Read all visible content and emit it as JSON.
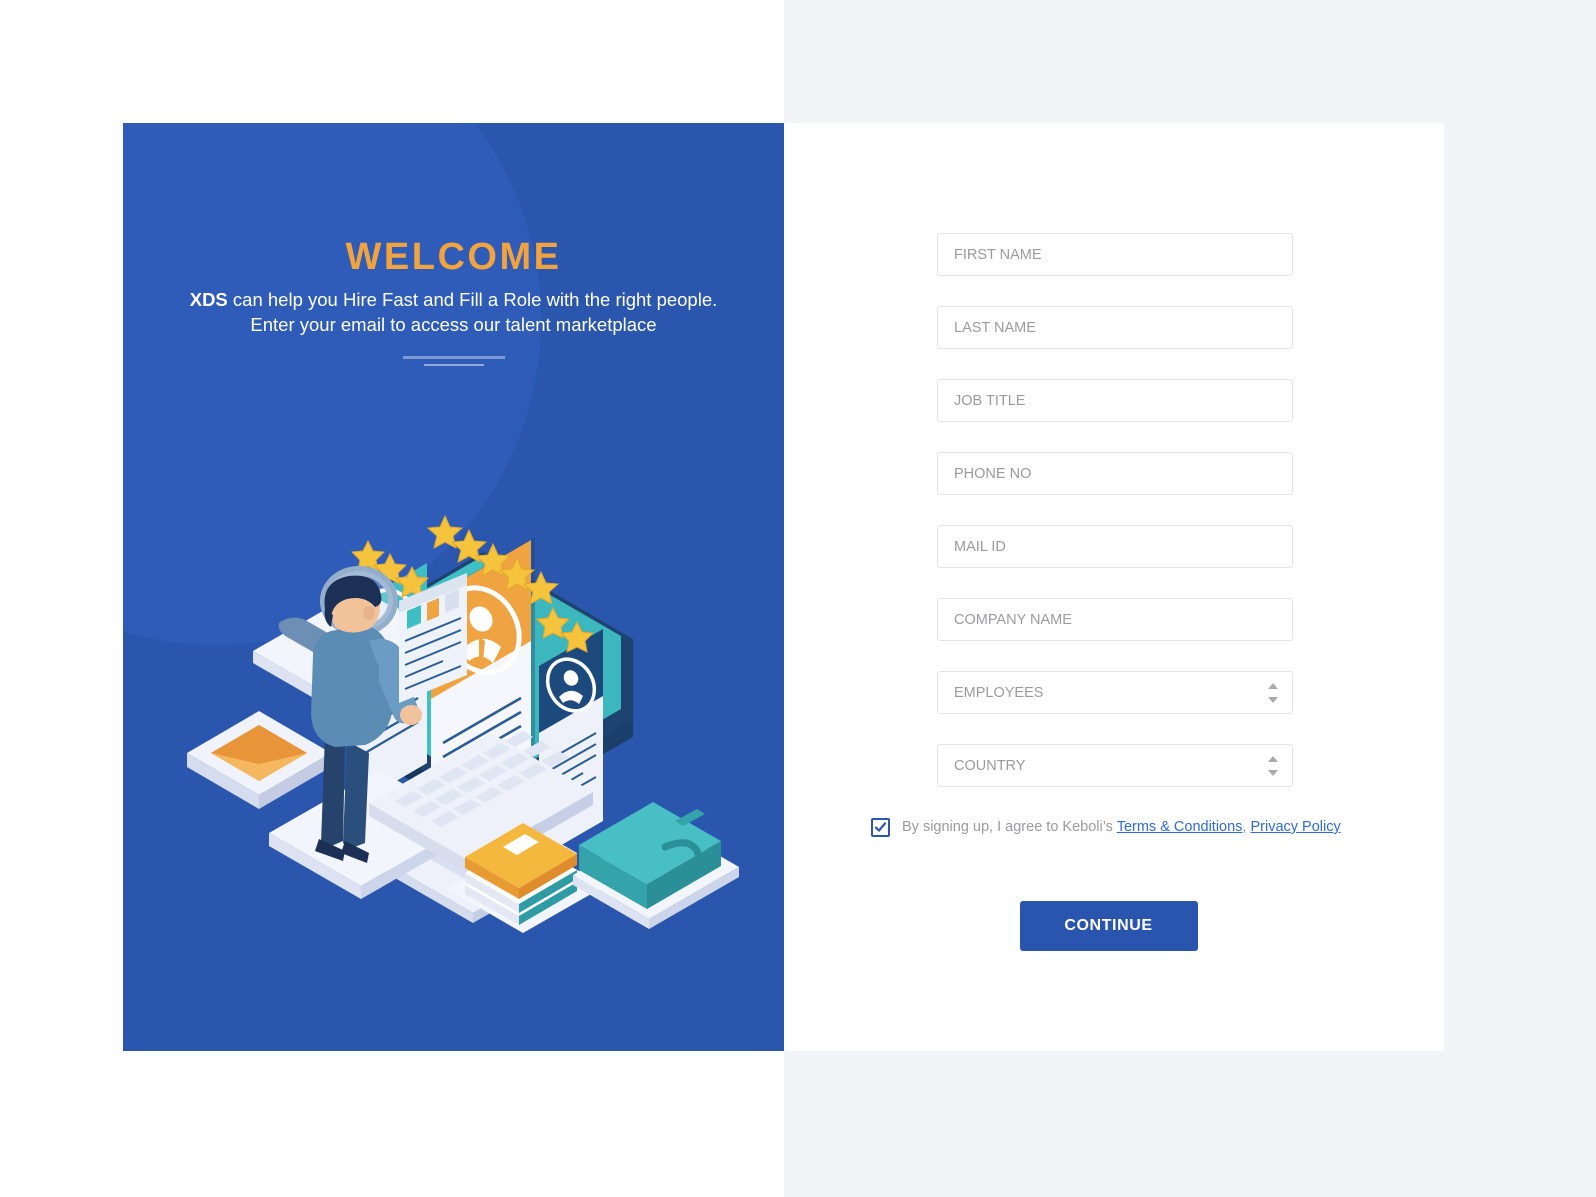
{
  "theme": {
    "brand_blue": "#2a56ae",
    "accent_orange": "#f0a33e",
    "link_blue": "#2f6bd8",
    "panel_bg": "#f3f4f8",
    "placeholder_grey": "#9b9b9e",
    "teal": "#3cb7bd"
  },
  "hero": {
    "title": "WELCOME",
    "subtitle_brand": "XDS",
    "subtitle_rest": " can help you Hire Fast and Fill a Role with the right people.",
    "subtitle_line2": "Enter your email to access our talent marketplace",
    "illustration_name": "recruiter-reviewing-candidate-profiles"
  },
  "form": {
    "fields": [
      {
        "name": "first-name",
        "placeholder": "FIRST NAME",
        "value": "",
        "type": "text"
      },
      {
        "name": "last-name",
        "placeholder": "LAST NAME",
        "value": "",
        "type": "text"
      },
      {
        "name": "job-title",
        "placeholder": "JOB TITLE",
        "value": "",
        "type": "text"
      },
      {
        "name": "phone-no",
        "placeholder": "PHONE NO",
        "value": "",
        "type": "text"
      },
      {
        "name": "mail-id",
        "placeholder": "MAIL ID",
        "value": "",
        "type": "text"
      },
      {
        "name": "company-name",
        "placeholder": "COMPANY NAME",
        "value": "",
        "type": "text"
      }
    ],
    "selects": [
      {
        "name": "employees",
        "label": "EMPLOYEES",
        "value": ""
      },
      {
        "name": "country",
        "label": "COUNTRY",
        "value": ""
      }
    ],
    "terms": {
      "checked": true,
      "prefix": "By signing up, I agree to Keboli’s ",
      "link_terms": "Terms & Conditions",
      "separator": ", ",
      "link_privacy": "Privacy Policy"
    },
    "submit_label": "CONTINUE"
  }
}
